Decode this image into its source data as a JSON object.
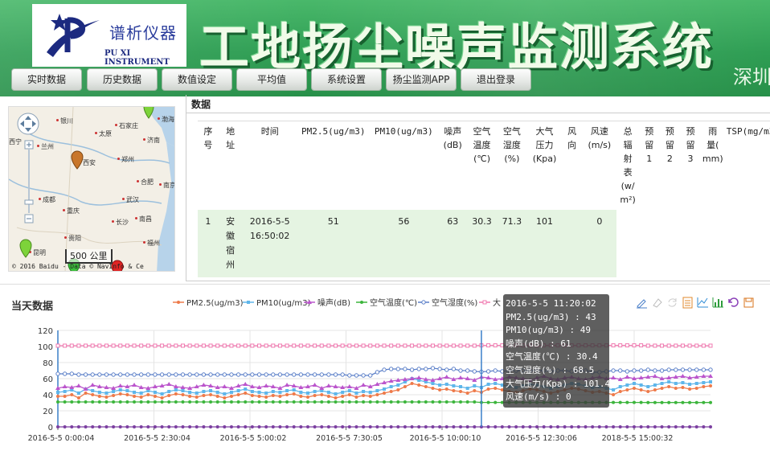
{
  "header": {
    "logo_cn": "谱析仪器",
    "logo_en": "PU XI INSTRUMENT",
    "title": "工地扬尘噪声监测系统",
    "subtitle": "深圳"
  },
  "nav": [
    {
      "label": "实时数据",
      "name": "nav-realtime-button"
    },
    {
      "label": "历史数据",
      "name": "nav-history-button"
    },
    {
      "label": "数值设定",
      "name": "nav-settings-value-button"
    },
    {
      "label": "平均值",
      "name": "nav-average-button"
    },
    {
      "label": "系统设置",
      "name": "nav-system-settings-button"
    },
    {
      "label": "扬尘监测APP",
      "name": "nav-app-button"
    },
    {
      "label": "退出登录",
      "name": "nav-logout-button"
    }
  ],
  "map": {
    "cities": [
      "银川",
      "太原",
      "石家庄",
      "济南",
      "兰州",
      "西安",
      "郑州",
      "合肥",
      "南京",
      "成都",
      "武汉",
      "重庆",
      "长沙",
      "南昌",
      "贵阳",
      "福州",
      "昆明",
      "西宁",
      "渤海"
    ],
    "scale": "500 公里",
    "copyright": "© 2016 Baidu - Data © NavInfo & Ce"
  },
  "data_panel": {
    "title": "数据",
    "columns": [
      "序\n号",
      "地\n址",
      "时间",
      "PM2.5(ug/m3)",
      "PM10(ug/m3)",
      "噪声\n(dB)",
      "空气\n温度\n(℃)",
      "空气\n湿度\n(%)",
      "大气\n压力\n(Kpa)",
      "风\n向",
      "风速\n(m/s)",
      "总\n辐\n射\n表\n(w/\nm²)",
      "预\n留\n1",
      "预\n留\n2",
      "预\n留\n3",
      "雨\n量(\nmm)",
      "TSP(mg/m3)"
    ],
    "rows": [
      [
        "1",
        "安\n徽\n宿\n州",
        "2016-5-5\n16:50:02",
        "51",
        "56",
        "63",
        "30.3",
        "71.3",
        "101",
        "",
        "0",
        "",
        "",
        "",
        "",
        "",
        ""
      ]
    ]
  },
  "chart_title": "当天数据",
  "tooltip": {
    "time": "2016-5-5 11:20:02",
    "lines": [
      "PM2.5(ug/m3) : 43",
      "PM10(ug/m3) : 49",
      "噪声(dB) : 61",
      "空气温度(℃) : 30.4",
      "空气湿度(%) : 68.5",
      "大气压力(Kpa) : 101.4",
      "风速(m/s) : 0"
    ]
  },
  "toolbox": [
    "mark-icon",
    "erase-icon",
    "refresh-icon",
    "data-view-icon",
    "line-chart-icon",
    "bar-chart-icon",
    "restore-icon",
    "save-image-icon"
  ],
  "chart_data": {
    "type": "line",
    "title": "当天数据",
    "xlabel": "",
    "ylabel": "",
    "ylim": [
      0,
      120
    ],
    "yticks": [
      0,
      20,
      40,
      60,
      80,
      100,
      120
    ],
    "xtick_labels": [
      "2016-5-5 0:00:04",
      "2016-5-5 2:30:04",
      "2016-5-5 5:00:02",
      "2016-5-5 7:30:05",
      "2016-5-5 10:00:10",
      "2016-5-5 12:30:06",
      "2018-5-5 15:00:32"
    ],
    "grid": true,
    "legend_position": "top",
    "series": [
      {
        "name": "PM2.5(ug/m3)",
        "color": "#ee7a4a",
        "marker": "circle",
        "values": [
          38,
          38,
          40,
          36,
          42,
          40,
          38,
          37,
          39,
          41,
          40,
          38,
          37,
          40,
          38,
          36,
          39,
          41,
          40,
          38,
          37,
          39,
          40,
          38,
          36,
          38,
          40,
          42,
          39,
          38,
          37,
          39,
          38,
          40,
          41,
          38,
          37,
          39,
          40,
          38,
          36,
          38,
          40,
          37,
          39,
          38,
          40,
          42,
          44,
          46,
          50,
          54,
          52,
          50,
          48,
          46,
          47,
          45,
          44,
          42,
          45,
          43,
          47,
          48,
          46,
          44,
          43,
          45,
          47,
          46,
          44,
          42,
          44,
          46,
          48,
          47,
          45,
          43,
          44,
          42,
          40,
          44,
          46,
          48,
          46,
          44,
          46,
          48,
          50,
          48,
          49,
          47,
          48,
          50,
          51
        ]
      },
      {
        "name": "PM10(ug/m3)",
        "color": "#5fb6ea",
        "marker": "square",
        "values": [
          43,
          44,
          46,
          42,
          47,
          45,
          43,
          42,
          44,
          46,
          45,
          43,
          42,
          45,
          43,
          41,
          44,
          46,
          45,
          43,
          42,
          44,
          45,
          43,
          41,
          43,
          45,
          47,
          44,
          43,
          42,
          44,
          43,
          45,
          46,
          43,
          42,
          44,
          45,
          43,
          41,
          43,
          45,
          42,
          44,
          43,
          45,
          47,
          50,
          52,
          56,
          60,
          58,
          56,
          54,
          52,
          53,
          51,
          50,
          48,
          51,
          49,
          53,
          54,
          52,
          50,
          49,
          51,
          53,
          52,
          50,
          48,
          50,
          52,
          54,
          53,
          51,
          49,
          50,
          48,
          46,
          50,
          52,
          54,
          52,
          50,
          52,
          54,
          56,
          54,
          55,
          53,
          54,
          55,
          56
        ]
      },
      {
        "name": "噪声(dB)",
        "color": "#bb55cc",
        "marker": "triangle",
        "values": [
          48,
          50,
          49,
          51,
          47,
          52,
          50,
          49,
          48,
          51,
          50,
          52,
          49,
          48,
          50,
          51,
          53,
          50,
          49,
          48,
          50,
          52,
          51,
          49,
          50,
          48,
          51,
          53,
          50,
          49,
          51,
          50,
          48,
          52,
          51,
          49,
          50,
          52,
          48,
          51,
          50,
          49,
          50,
          48,
          52,
          50,
          53,
          55,
          57,
          58,
          59,
          60,
          61,
          59,
          58,
          60,
          62,
          59,
          61,
          60,
          58,
          62,
          61,
          59,
          60,
          62,
          61,
          60,
          58,
          61,
          63,
          60,
          59,
          61,
          62,
          60,
          59,
          61,
          62,
          60,
          61,
          59,
          62,
          60,
          61,
          62,
          63,
          60,
          61,
          62,
          63,
          61,
          62,
          63,
          63
        ]
      },
      {
        "name": "空气温度(℃)",
        "color": "#3cb53c",
        "marker": "circle",
        "values": [
          31,
          31,
          31,
          31,
          31,
          31,
          31,
          31,
          31,
          31,
          31,
          31,
          31,
          31,
          31,
          31,
          31,
          31,
          31,
          31,
          31,
          31,
          31,
          31,
          31,
          31,
          31,
          31,
          31,
          31,
          31,
          31,
          31,
          31,
          31,
          31,
          31,
          31,
          31,
          31,
          31,
          31,
          31,
          31,
          31,
          31,
          31,
          31,
          31,
          31,
          31,
          31,
          31,
          31,
          31,
          31,
          31,
          31,
          31,
          31,
          31,
          30.4,
          30.4,
          30.4,
          30.4,
          30.4,
          30.4,
          30.4,
          30.4,
          30.4,
          30.4,
          30.4,
          30.4,
          30.4,
          30.4,
          30.4,
          30.4,
          30.4,
          30.4,
          30.4,
          30.4,
          30.4,
          30.4,
          30.4,
          30.4,
          30.3,
          30.3,
          30.3,
          30.3,
          30.3,
          30.3,
          30.3,
          30.3,
          30.3,
          30.3
        ]
      },
      {
        "name": "空气湿度(%)",
        "color": "#5b7fc8",
        "marker": "circle-open",
        "values": [
          66,
          66,
          66,
          65,
          65,
          65,
          65,
          65,
          65,
          65,
          65,
          65,
          65,
          65,
          65,
          65,
          65,
          65,
          65,
          65,
          65,
          65,
          65,
          65,
          65,
          65,
          65,
          65,
          65,
          65,
          65,
          65,
          65,
          65,
          65,
          65,
          65,
          65,
          65,
          65,
          65,
          65,
          64,
          64,
          64,
          64,
          68,
          71,
          72,
          72,
          72,
          71,
          72,
          72,
          73,
          72,
          71,
          72,
          70,
          70,
          69,
          68.5,
          69,
          70,
          69,
          70,
          70,
          70,
          70,
          70,
          70,
          69,
          70,
          70,
          69,
          70,
          70,
          68,
          68,
          69,
          70,
          70,
          69,
          70,
          70,
          71,
          70,
          70,
          71,
          71,
          71,
          71,
          71,
          71,
          71
        ]
      },
      {
        "name": "大气压力(Kpa)",
        "color": "#f07ab0",
        "marker": "square-open",
        "values": [
          101,
          101,
          101,
          101,
          101,
          101,
          101,
          101,
          101,
          101,
          101,
          101,
          101,
          101,
          101,
          101,
          101,
          101,
          101,
          101,
          101,
          101,
          101,
          101,
          101,
          101,
          101,
          101,
          101,
          101,
          101,
          101,
          101,
          101,
          101,
          101,
          101,
          101,
          101,
          101,
          101,
          101,
          101,
          101,
          101,
          101,
          101,
          101,
          101,
          101,
          101,
          101,
          101,
          101,
          101,
          101,
          101,
          101,
          101,
          101,
          101,
          101.4,
          101.4,
          101.4,
          101.4,
          101.4,
          101.4,
          101.4,
          101.4,
          101.4,
          101.4,
          101.4,
          101.4,
          101.4,
          101.4,
          101.4,
          101.4,
          101.4,
          101.4,
          101.4,
          101.4,
          101.4,
          101.4,
          101.4,
          101.4,
          101,
          101,
          101,
          101,
          101,
          101,
          101,
          101,
          101,
          101
        ]
      },
      {
        "name": "风速(m/s)",
        "color": "#7b3fa0",
        "marker": "circle",
        "values": [
          0,
          0,
          0,
          0,
          0,
          0,
          0,
          0,
          0,
          0,
          0,
          0,
          0,
          0,
          0,
          0,
          0,
          0,
          0,
          0,
          0,
          0,
          0,
          0,
          0,
          0,
          0,
          0,
          0,
          0,
          0,
          0,
          0,
          0,
          0,
          0,
          0,
          0,
          0,
          0,
          0,
          0,
          0,
          0,
          0,
          0,
          0,
          0,
          0,
          0,
          0,
          0,
          0,
          0,
          0,
          0,
          0,
          0,
          0,
          0,
          0,
          0,
          0,
          0,
          0,
          0,
          0,
          0,
          0,
          0,
          0,
          0,
          0,
          0,
          0,
          0,
          0,
          0,
          0,
          0,
          0,
          0,
          0,
          0,
          0,
          0,
          0,
          0,
          0,
          0,
          0,
          0,
          0,
          0,
          0
        ]
      }
    ],
    "legend_shown": [
      "PM2.5(ug/m3)",
      "PM10(ug/m3)",
      "噪声(dB)",
      "空气温度(℃)",
      "空气湿度(%)",
      "大"
    ],
    "highlight_index": 61
  }
}
